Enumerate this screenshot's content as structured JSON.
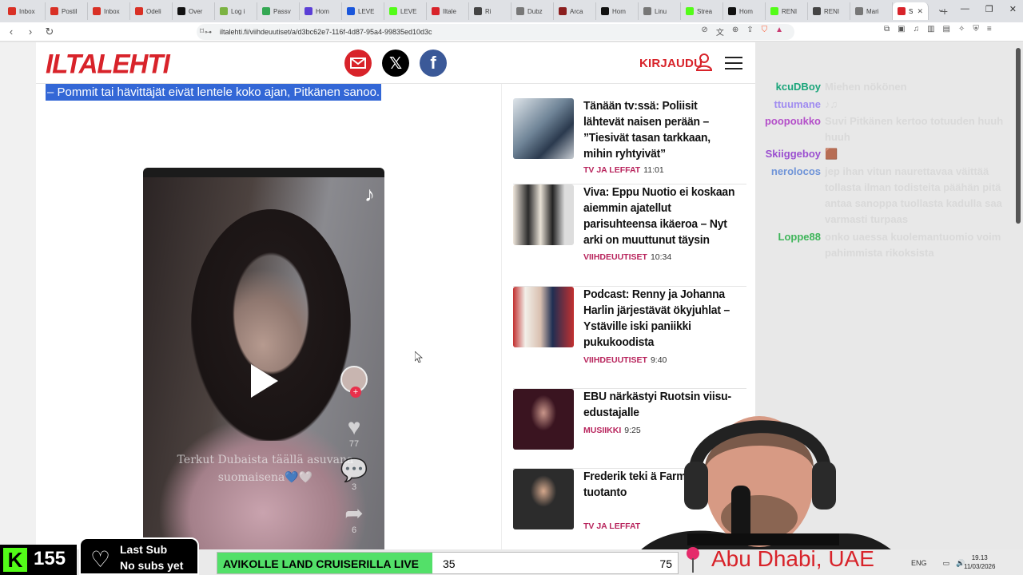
{
  "browser": {
    "tabs": [
      {
        "label": "Inbox",
        "color": "#d93025"
      },
      {
        "label": "Postil",
        "color": "#d93025"
      },
      {
        "label": "Inbox",
        "color": "#d93025"
      },
      {
        "label": "Odeli",
        "color": "#d93025"
      },
      {
        "label": "Over",
        "color": "#111111"
      },
      {
        "label": "Log i",
        "color": "#7cb342"
      },
      {
        "label": "Passv",
        "color": "#34a853"
      },
      {
        "label": "Hom",
        "color": "#5b3fd6"
      },
      {
        "label": "LEVE",
        "color": "#1a56db"
      },
      {
        "label": "LEVE",
        "color": "#53fc18"
      },
      {
        "label": "Iltale",
        "color": "#d8232a"
      },
      {
        "label": "Ri",
        "color": "#444444"
      },
      {
        "label": "Dubz",
        "color": "#777777"
      },
      {
        "label": "Arca",
        "color": "#8b1e1e"
      },
      {
        "label": "Hom",
        "color": "#111111"
      },
      {
        "label": "Linu",
        "color": "#777777"
      },
      {
        "label": "Strea",
        "color": "#53fc18"
      },
      {
        "label": "Hom",
        "color": "#111111"
      },
      {
        "label": "RENI",
        "color": "#53fc18"
      },
      {
        "label": "RENI",
        "color": "#444444"
      },
      {
        "label": "Mari",
        "color": "#777777"
      }
    ],
    "active_tab": {
      "label": "S",
      "color": "#d8232a"
    },
    "url": "iltalehti.fi/viihdeuutiset/a/d3bc62e7-116f-4d87-95a4-99835ed10d3c"
  },
  "site": {
    "logo": "ILTALEHTI",
    "login_label": "KIRJAUDU",
    "highlight_text": "– Pommit tai hävittäjät eivät lentele koko ajan, Pitkänen sanoo.",
    "video": {
      "caption": "Terkut Dubaista täällä asuvana suomaisena💙🤍",
      "likes": "77",
      "comments": "3",
      "shares": "6"
    }
  },
  "sidebar": {
    "items": [
      {
        "title": "Tänään tv:ssä: Poliisit lähtevät naisen perään – ”Tiesivät tasan tarkkaan, mihin ryhtyivät”",
        "category": "TV JA LEFFAT",
        "time": "11:01"
      },
      {
        "title": "Viva: Eppu Nuotio ei koskaan aiemmin ajatellut parisuhteensa ikäeroa – Nyt arki on muuttunut täysin",
        "category": "VIIHDEUUTISET",
        "time": "10:34"
      },
      {
        "title": "Podcast: Renny ja Johanna Harlin järjestävät ökyjuhlat – Ystäville iski paniikki pukukoodista",
        "category": "VIIHDEUUTISET",
        "time": "9:40"
      },
      {
        "title": "EBU närkästyi Ruotsin viisu-edustajalle",
        "category": "MUSIIKKI",
        "time": "9:25"
      },
      {
        "title": "Frederik teki ä Farmissa – Nyt tuotanto",
        "category": "TV JA LEFFAT",
        "time": ""
      }
    ]
  },
  "chat": [
    {
      "user": "kcuDBoy",
      "color": "#1aa57a",
      "msg": "Miehen nökönen"
    },
    {
      "user": "ttuumane",
      "color": "#a08cf0",
      "msg": "♪♫"
    },
    {
      "user": "poopoukko",
      "color": "#b44fc9",
      "msg": "Suvi Pitkänen kertoo totuuden huuh huuh"
    },
    {
      "user": "Skiiggeboy",
      "color": "#9b4fd0",
      "msg": "🟫"
    },
    {
      "user": "nerolocos",
      "color": "#6f94d8",
      "msg": "jep ihan vitun naurettavaa väittää tollasta ilman todisteita päähän pitä antaa sanoppa tuollasta kadulla saa varmasti turpaas"
    },
    {
      "user": "Loppe88",
      "color": "#3fb55a",
      "msg": "onko uaessa kuolemantuomio voim pahimmista rikoksista"
    }
  ],
  "overlay": {
    "kick_count": "155",
    "last_sub_title": "Last Sub",
    "last_sub_value": "No subs yet",
    "goal_label": "AVIKOLLE LAND CRUISERILLA LIVE",
    "goal_current": "35",
    "goal_max": "75",
    "goal_fraction": 0.467,
    "location": "Abu Dhabi, UAE",
    "clock_time": "19.13",
    "clock_date": "11/03/2026",
    "lang": "ENG"
  }
}
